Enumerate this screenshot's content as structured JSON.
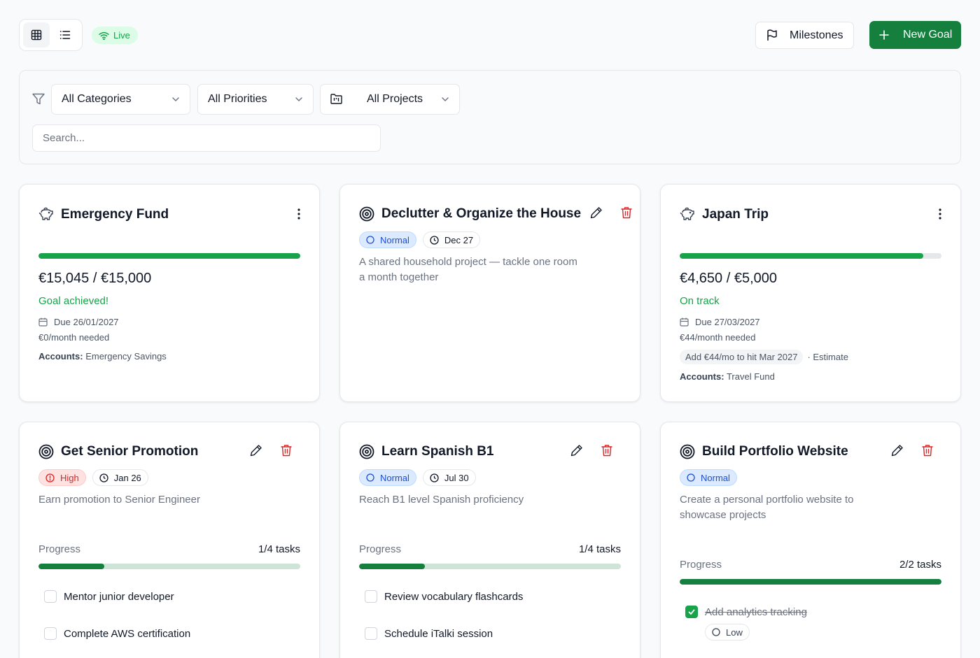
{
  "toolbar": {
    "live_label": "Live",
    "milestones_label": "Milestones",
    "new_goal_label": "New Goal"
  },
  "filters": {
    "category": "All Categories",
    "priority": "All Priorities",
    "project": "All Projects",
    "search_placeholder": "Search..."
  },
  "colors": {
    "accent": "#15803d",
    "success": "#16a34a",
    "danger": "#dc2626",
    "normal": "#1d4ed8"
  },
  "cards": [
    {
      "title": "Emergency Fund",
      "icon": "piggy-bank-icon",
      "progress_fraction": 1.0,
      "amount": "€15,045 / €15,000",
      "status": "Goal achieved!",
      "due": "Due 26/01/2027",
      "monthly": "€0/month needed",
      "accounts_label": "Accounts:",
      "accounts_value": "Emergency Savings"
    },
    {
      "title": "Declutter & Organize the House",
      "icon": "target-icon",
      "priority": "Normal",
      "date": "Dec 27",
      "description": "A shared household project — tackle one room a month together"
    },
    {
      "title": "Japan Trip",
      "icon": "piggy-bank-icon",
      "progress_fraction": 0.93,
      "amount": "€4,650 / €5,000",
      "status": "On track",
      "due": "Due 27/03/2027",
      "monthly": "€44/month needed",
      "estimate_chip": "Add €44/mo to hit Mar 2027",
      "estimate_suffix": "· Estimate",
      "accounts_label": "Accounts:",
      "accounts_value": "Travel Fund"
    },
    {
      "title": "Get Senior Promotion",
      "icon": "target-icon",
      "priority": "High",
      "date": "Jan 26",
      "description": "Earn promotion to Senior Engineer",
      "progress_label": "Progress",
      "progress_count": "1/4 tasks",
      "progress_fraction": 0.25,
      "tasks": [
        {
          "label": "Mentor junior developer",
          "done": false
        },
        {
          "label": "Complete AWS certification",
          "done": false
        }
      ]
    },
    {
      "title": "Learn Spanish B1",
      "icon": "target-icon",
      "priority": "Normal",
      "date": "Jul 30",
      "description": "Reach B1 level Spanish proficiency",
      "progress_label": "Progress",
      "progress_count": "1/4 tasks",
      "progress_fraction": 0.25,
      "tasks": [
        {
          "label": "Review vocabulary flashcards",
          "done": false
        },
        {
          "label": "Schedule iTalki session",
          "done": false
        }
      ]
    },
    {
      "title": "Build Portfolio Website",
      "icon": "target-icon",
      "priority": "Normal",
      "description": "Create a personal portfolio website to showcase projects",
      "progress_label": "Progress",
      "progress_count": "2/2 tasks",
      "progress_fraction": 1.0,
      "tasks": [
        {
          "label": "Add analytics tracking",
          "done": true,
          "priority": "Low"
        }
      ]
    }
  ]
}
